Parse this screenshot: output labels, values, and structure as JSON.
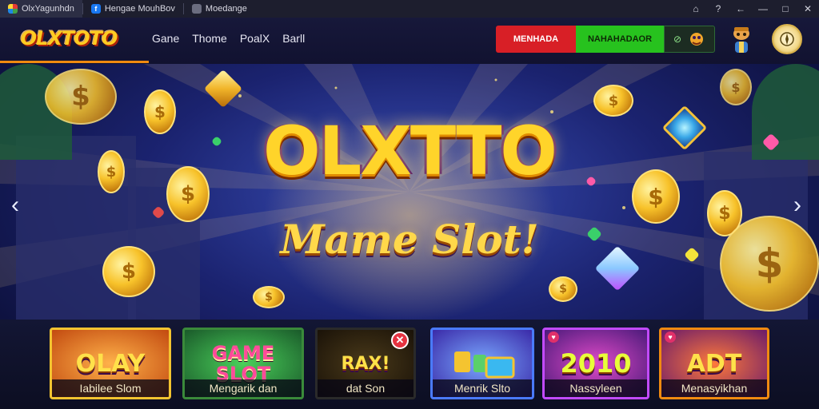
{
  "browser": {
    "tabs": [
      {
        "title": "OlxYagunhdn",
        "icon": "multicolor-favicon-icon"
      },
      {
        "title": "Hengae MouhBov",
        "icon": "facebook-icon"
      },
      {
        "title": "Moedange",
        "icon": "document-icon"
      }
    ],
    "controls": [
      "⌂",
      "?",
      "←",
      "—",
      "□",
      "✕"
    ]
  },
  "header": {
    "logo_text": "OLXTOTO",
    "nav": [
      "Gane",
      "Thome",
      "PoalX",
      "Barll"
    ],
    "login_label": "MENHADA",
    "register_label": "NAHAHADAOR",
    "mini_label": "⊘",
    "colors": {
      "login": "#d81f26",
      "register": "#27c21e",
      "accent": "#f08a10"
    }
  },
  "hero": {
    "title": "OLXTTO",
    "subtitle": "Mame Slot!",
    "prev_arrow": "‹",
    "next_arrow": "›"
  },
  "games": [
    {
      "art": "OLAY",
      "label": "Iabilee Slom"
    },
    {
      "art": "GAME SLOT",
      "label": "Mengarik dan"
    },
    {
      "art": "RAX!",
      "label": "dat Son"
    },
    {
      "art": "",
      "label": "Menrik Slto"
    },
    {
      "art": "2010",
      "label": "Nassyleen"
    },
    {
      "art": "ADT",
      "label": "Menasyikhan"
    }
  ]
}
